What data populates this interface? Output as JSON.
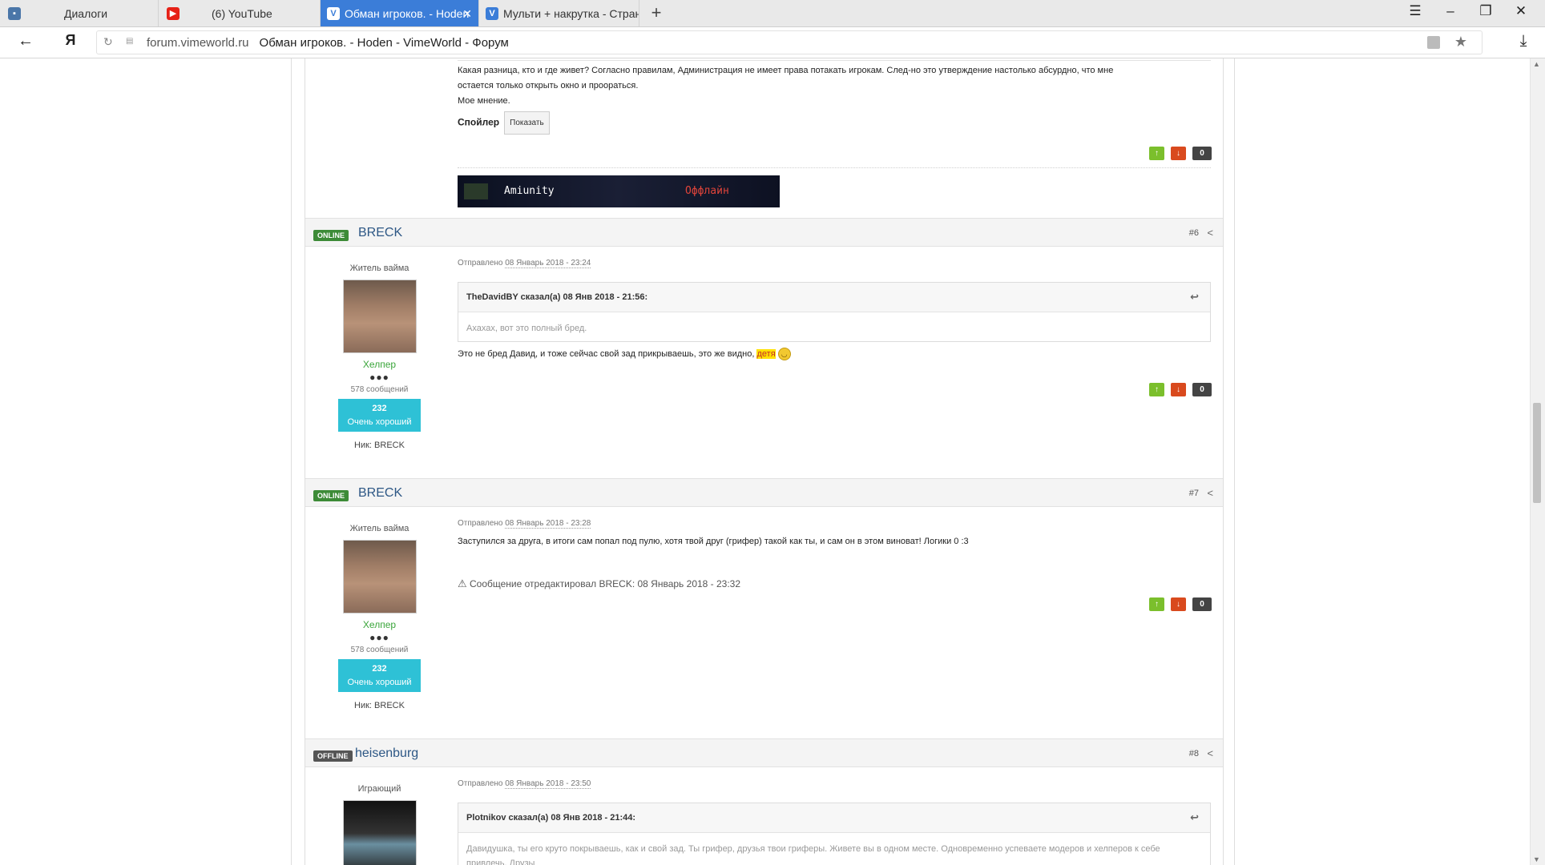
{
  "browser": {
    "tabs": [
      {
        "label": "Диалоги",
        "favicon_color": "#4a76a8"
      },
      {
        "label": "(6) YouTube",
        "favicon_color": "#e62117"
      },
      {
        "label": "Обман игроков. - Hoden",
        "favicon_color": "#ffffff",
        "active": true
      },
      {
        "label": "Мульти + накрутка - Стран",
        "favicon_color": "#3b7dd8"
      }
    ],
    "address": {
      "host": "forum.vimeworld.ru",
      "title": "Обман игроков. - Hoden - VimeWorld - Форум"
    },
    "logo": "Я"
  },
  "post5": {
    "text_line1": "Какая разница, кто и где живет? Согласно правилам, Администрация не имеет права потакать игрокам. След-но это утверждение настолько абсурдно, что мне",
    "text_line2": "остается только открыть окно и проораться.",
    "text_line3": "Мое мнение.",
    "spoiler_label": "Спойлер",
    "spoiler_button": "Показать",
    "score": "0",
    "signature_left": "Amiunity",
    "signature_right": "Оффлайн"
  },
  "post6": {
    "status": "ONLINE",
    "username": "BRECK",
    "number": "#6",
    "group": "Житель вайма",
    "rank": "Хелпер",
    "pips": "●●●",
    "posts": "578 сообщений",
    "rep_value": "232",
    "rep_label": "Очень хороший",
    "nick": "Ник: BRECK",
    "posted_prefix": "Отправлено",
    "posted_date": "08 Январь 2018 - 23:24",
    "quote_header": "TheDavidBY сказал(а) 08 Янв 2018 - 21:56:",
    "quote_text": "Ахахах, вот это полный бред.",
    "text": "Это не бред Давид, и тоже сейчас свой зад прикрываешь, это же видно,",
    "highlight": "детя",
    "score": "0"
  },
  "post7": {
    "status": "ONLINE",
    "username": "BRECK",
    "number": "#7",
    "group": "Житель вайма",
    "rank": "Хелпер",
    "pips": "●●●",
    "posts": "578 сообщений",
    "rep_value": "232",
    "rep_label": "Очень хороший",
    "nick": "Ник: BRECK",
    "posted_prefix": "Отправлено",
    "posted_date": "08 Январь 2018 - 23:28",
    "text": "Заступился за друга, в итоги сам попал под пулю, хотя твой друг (грифер) такой как ты, и сам он в этом виноват! Логики 0 :3",
    "edit_note": "Сообщение отредактировал BRECK: 08 Январь 2018 - 23:32",
    "score": "0"
  },
  "post8": {
    "status": "OFFLINE",
    "username": "heisenburg",
    "number": "#8",
    "group": "Играющий",
    "posted_prefix": "Отправлено",
    "posted_date": "08 Январь 2018 - 23:50",
    "quote_header": "Plotnikov сказал(а) 08 Янв 2018 - 21:44:",
    "quote_text": "Давидушка, ты его круто покрываешь, как и свой зад. Ты грифер, друзья твои гриферы. Живете вы в одном месте. Одновременно успеваете модеров и хелперов к себе привлечь. Друзы"
  },
  "colors": {
    "online": "#3d8b37",
    "offline": "#555555",
    "rep": "#2ec1d6",
    "vote_up": "#7bbf2c",
    "vote_down": "#d94a1e",
    "link": "#2d5785"
  }
}
